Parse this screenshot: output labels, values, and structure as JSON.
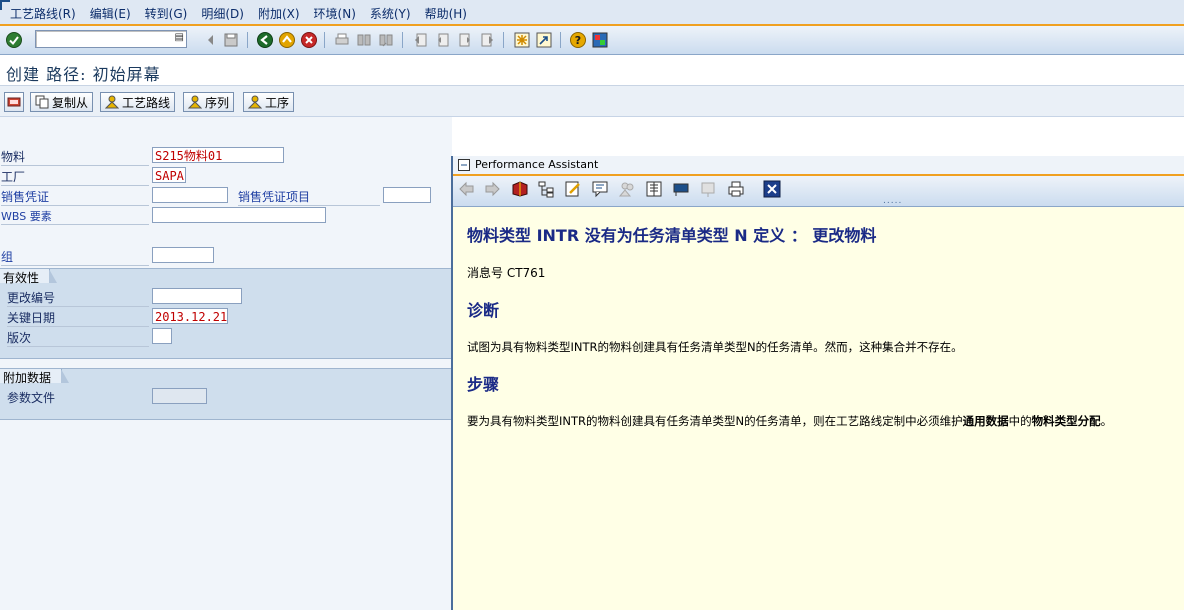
{
  "menu": [
    "工艺路线(R)",
    "编辑(E)",
    "转到(G)",
    "明细(D)",
    "附加(X)",
    "环境(N)",
    "系统(Y)",
    "帮助(H)"
  ],
  "toolbar": {
    "command_value": "",
    "icons": [
      "check-icon",
      "save-icon",
      "back-icon",
      "exit-icon",
      "cancel-icon",
      "print-icon",
      "find-icon",
      "find-next-icon",
      "first-page-icon",
      "prev-page-icon",
      "next-page-icon",
      "last-page-icon",
      "new-session-icon",
      "shortcut-icon",
      "help-icon",
      "layout-icon"
    ]
  },
  "title": "创建 路径: 初始屏幕",
  "app_buttons": [
    {
      "label": "复制从"
    },
    {
      "label": "工艺路线"
    },
    {
      "label": "序列"
    },
    {
      "label": "工序"
    }
  ],
  "form": {
    "material_label": "物料",
    "material_value": "S215物料01",
    "plant_label": "工厂",
    "plant_value": "SAPA",
    "sales_doc_label": "销售凭证",
    "sales_doc_value": "",
    "sales_item_label": "销售凭证项目",
    "sales_item_value": "",
    "wbs_label": "WBS 要素",
    "wbs_value": "",
    "group_label": "组",
    "group_value": "",
    "validity_title": "有效性",
    "change_no_label": "更改编号",
    "change_no_value": "",
    "key_date_label": "关键日期",
    "key_date_value": "2013.12.21",
    "revision_label": "版次",
    "revision_value": "",
    "additional_title": "附加数据",
    "profile_label": "参数文件",
    "profile_value": ""
  },
  "pa": {
    "title": "Performance Assistant",
    "grip": ".....",
    "heading": "物料类型  INTR 没有为任务清单类型  N 定义  ：  更改物料",
    "message_no": "消息号  CT761",
    "diag_title": "诊断",
    "diag_text": "试图为具有物料类型INTR的物料创建具有任务清单类型N的任务清单。然而，这种集合并不存在。",
    "proc_title": "步骤",
    "proc_text_1": "要为具有物料类型INTR的物料创建具有任务清单类型N的任务清单，则在工艺路线定制中必须维护",
    "proc_bold_1": "通用数据",
    "proc_text_2": "中的",
    "proc_bold_2": "物料类型分配",
    "proc_text_3": "。"
  }
}
